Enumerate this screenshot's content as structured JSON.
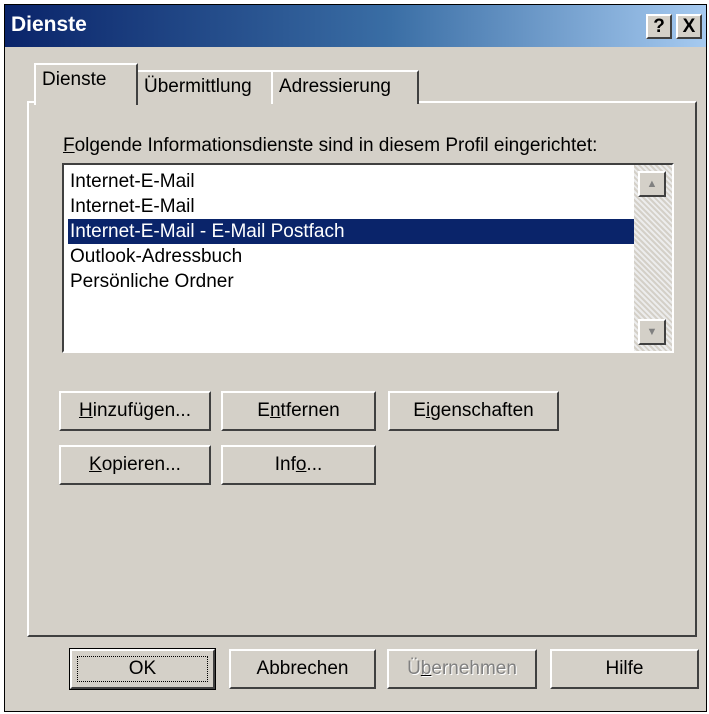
{
  "window": {
    "title": "Dienste",
    "help_button": "?",
    "close_button": "X"
  },
  "tabs": [
    {
      "label": "Dienste",
      "active": true
    },
    {
      "label": "Übermittlung",
      "active": false
    },
    {
      "label": "Adressierung",
      "active": false
    }
  ],
  "services": {
    "label_mnemonic": "F",
    "label_rest": "olgende Informationsdienste sind in diesem Profil eingerichtet:",
    "items": [
      {
        "label": "Internet-E-Mail",
        "selected": false
      },
      {
        "label": "Internet-E-Mail",
        "selected": false
      },
      {
        "label": "Internet-E-Mail - E-Mail Postfach",
        "selected": true
      },
      {
        "label": "Outlook-Adressbuch",
        "selected": false
      },
      {
        "label": "Persönliche Ordner",
        "selected": false
      }
    ],
    "scroll_up": "▲",
    "scroll_down": "▼"
  },
  "actions": {
    "add": {
      "pre": "",
      "mn": "H",
      "post": "inzufügen..."
    },
    "remove": {
      "pre": "E",
      "mn": "n",
      "post": "tfernen"
    },
    "properties": {
      "pre": "E",
      "mn": "i",
      "post": "genschaften"
    },
    "copy": {
      "pre": "",
      "mn": "K",
      "post": "opieren..."
    },
    "info": {
      "pre": "Inf",
      "mn": "o",
      "post": "..."
    }
  },
  "footer": {
    "ok": "OK",
    "cancel": "Abbrechen",
    "apply": {
      "pre": "Ü",
      "mn": "b",
      "post": "ernehmen"
    },
    "help": "Hilfe"
  },
  "colors": {
    "selection": "#0a246a",
    "face": "#d4d0c8"
  }
}
